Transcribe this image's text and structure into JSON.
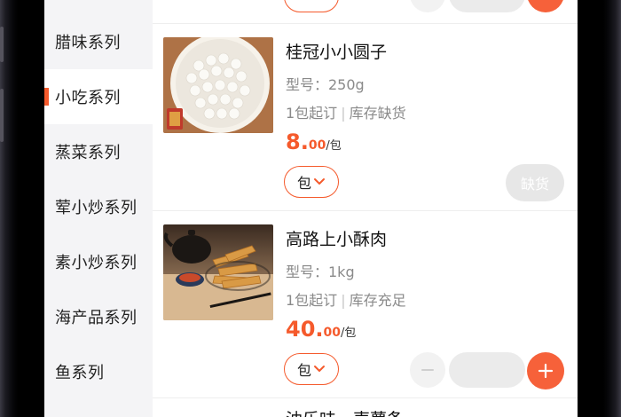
{
  "sidebar": {
    "categories": [
      {
        "label": "腊味系列",
        "active": false
      },
      {
        "label": "小吃系列",
        "active": true
      },
      {
        "label": "蒸菜系列",
        "active": false
      },
      {
        "label": "荤小炒系列",
        "active": false
      },
      {
        "label": "素小炒系列",
        "active": false
      },
      {
        "label": "海产品系列",
        "active": false
      },
      {
        "label": "鱼系列",
        "active": false
      }
    ]
  },
  "products": [
    {
      "name": "桂冠小小圆子",
      "spec": "型号：250g",
      "moq": "1包起订",
      "stock": "库存缺货",
      "price_int": "8.",
      "price_dec": "00",
      "price_unit": "/包",
      "unit_option": "包",
      "out_of_stock_label": "缺货"
    },
    {
      "name": "高路上小酥肉",
      "spec": "型号：1kg",
      "moq": "1包起订",
      "stock": "库存充足",
      "price_int": "40.",
      "price_dec": "00",
      "price_unit": "/包",
      "unit_option": "包",
      "quantity": ""
    }
  ],
  "next_product_partial_name": "油乐味一声薯条",
  "colors": {
    "accent": "#f55a2c",
    "sidebar_bg": "#f4f4f6",
    "muted_text": "#8a8a8a",
    "disabled_button": "#e7e7e7"
  },
  "icons": {
    "unit_dropdown": "chevron-down-icon",
    "decrease": "minus-icon",
    "increase": "plus-icon"
  }
}
